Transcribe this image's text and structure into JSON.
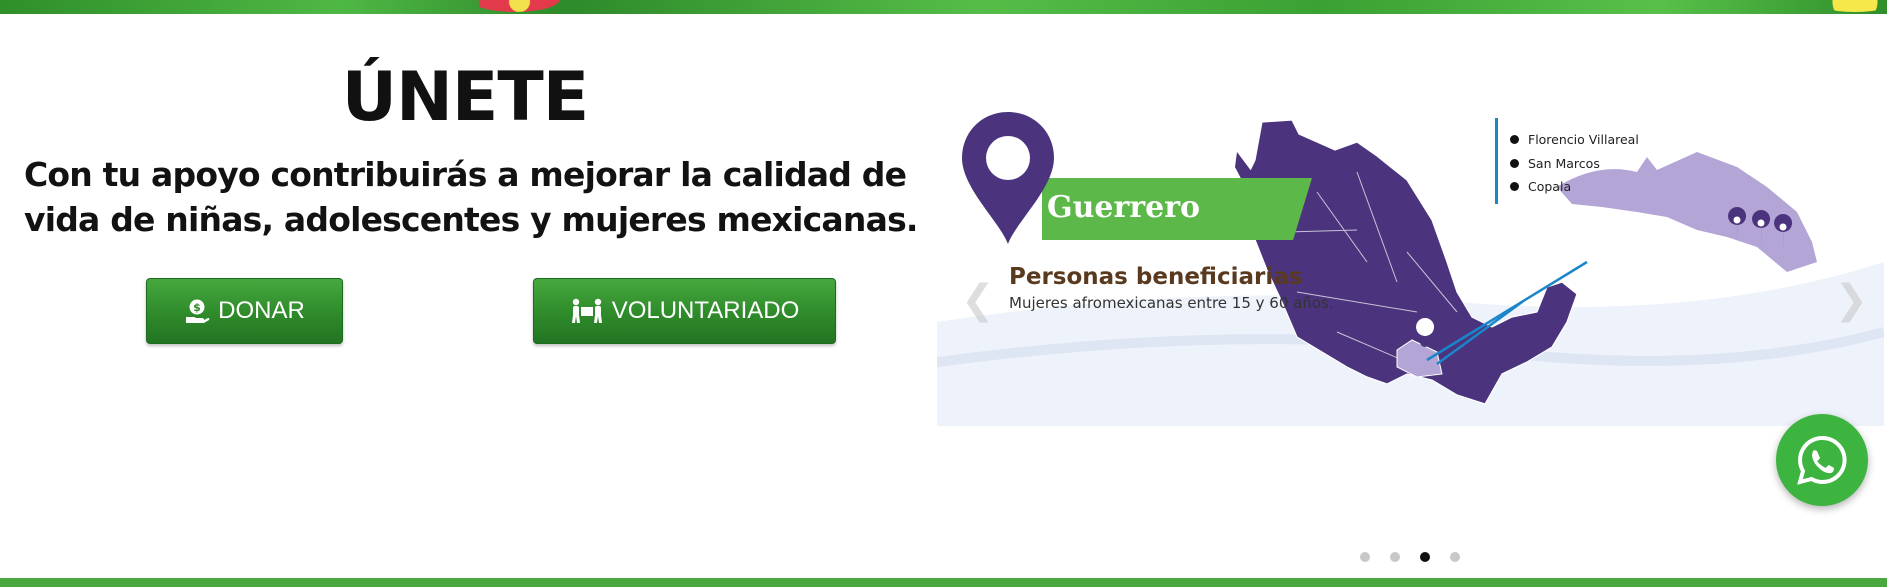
{
  "header": {
    "title": "ÚNETE",
    "subtitle": "Con tu apoyo contribuirás a mejorar la calidad de vida de niñas, adolescentes y mujeres mexicanas."
  },
  "buttons": {
    "donar_label": "DONAR",
    "donar_icon": "money-hand-icon",
    "voluntariado_label": "VOLUNTARIADO",
    "voluntariado_icon": "people-carry-icon"
  },
  "carousel": {
    "slide": {
      "state": "Guerrero",
      "beneficiaries_title": "Personas beneficiarias",
      "beneficiaries_desc": "Mujeres afromexicanas entre 15 y 60 años.",
      "municipalities": [
        "Florencio Villareal",
        "San Marcos",
        "Copala"
      ]
    },
    "prev_icon": "chevron-left-icon",
    "next_icon": "chevron-right-icon",
    "indicators": [
      {
        "active": false
      },
      {
        "active": false
      },
      {
        "active": true
      },
      {
        "active": false
      }
    ]
  },
  "whatsapp": {
    "icon": "whatsapp-icon"
  },
  "colors": {
    "brand_green": "#3c9d35",
    "purple": "#4b347d",
    "light_purple": "#b3a5d5",
    "whatsapp_green": "#3db340"
  }
}
